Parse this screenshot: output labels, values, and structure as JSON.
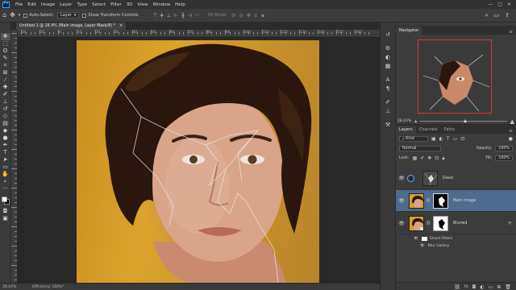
{
  "app": {
    "logo_text": "Ps",
    "menu": [
      "File",
      "Edit",
      "Image",
      "Layer",
      "Type",
      "Select",
      "Filter",
      "3D",
      "View",
      "Window",
      "Help"
    ],
    "window_controls": [
      "—",
      "□",
      "✕"
    ]
  },
  "options_bar": {
    "auto_select_label": "Auto-Select:",
    "auto_select_value": "Layer",
    "show_transform_label": "Show Transform Controls",
    "mode_3d_label": "3D Mode:"
  },
  "document": {
    "tab_title": "Untitled-1 @ 28.4% (Main image, Layer Mask/8) *",
    "close_label": "×"
  },
  "ruler": {
    "top_labels": [
      "20",
      "10",
      "0",
      "10",
      "20",
      "30",
      "40",
      "50",
      "60",
      "70",
      "80",
      "90",
      "100",
      "110",
      "120",
      "130",
      "140",
      "150",
      "160"
    ]
  },
  "status_bar": {
    "zoom": "28.43%",
    "info": "Efficiency: 100%*"
  },
  "navigator": {
    "tabs": [
      "Navigator"
    ],
    "zoom": "28.43%"
  },
  "layers": {
    "tabs": [
      "Layers",
      "Channels",
      "Paths"
    ],
    "kind_label": "Kind",
    "blend_mode": "Normal",
    "opacity_label": "Opacity:",
    "opacity_value": "100%",
    "lock_label": "Lock:",
    "fill_label": "Fill:",
    "fill_value": "100%",
    "items": [
      {
        "name": "Glass",
        "selected": false
      },
      {
        "name": "Main image",
        "selected": true
      },
      {
        "name": "Blurred",
        "selected": false
      }
    ],
    "smart_filters_label": "Smart Filters",
    "blur_gallery_label": "Blur Gallery"
  },
  "colors": {
    "app_bg": "#535353",
    "selected_layer": "#4d6b8c",
    "navigator_frame": "#d23a3a",
    "photo_background": "#d9a02b"
  }
}
